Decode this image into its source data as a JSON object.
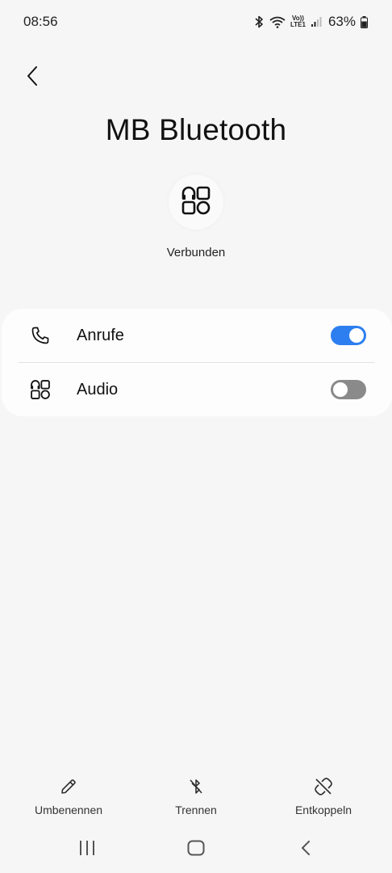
{
  "status_bar": {
    "time": "08:56",
    "volte_top": "Vo))",
    "volte_bottom": "LTE1",
    "battery_percent": "63%"
  },
  "header": {
    "title": "MB Bluetooth"
  },
  "device": {
    "icon": "headphones-apps-icon",
    "status": "Verbunden"
  },
  "settings": {
    "items": [
      {
        "label": "Anrufe",
        "icon": "phone-icon",
        "enabled": true
      },
      {
        "label": "Audio",
        "icon": "headphones-apps-icon",
        "enabled": false
      }
    ]
  },
  "actions": {
    "rename_label": "Umbenennen",
    "disconnect_label": "Trennen",
    "unpair_label": "Entkoppeln"
  },
  "colors": {
    "accent": "#2d7ff0",
    "background": "#f6f6f6",
    "card": "#fdfdfd",
    "toggle_off": "#8a8a8a"
  }
}
